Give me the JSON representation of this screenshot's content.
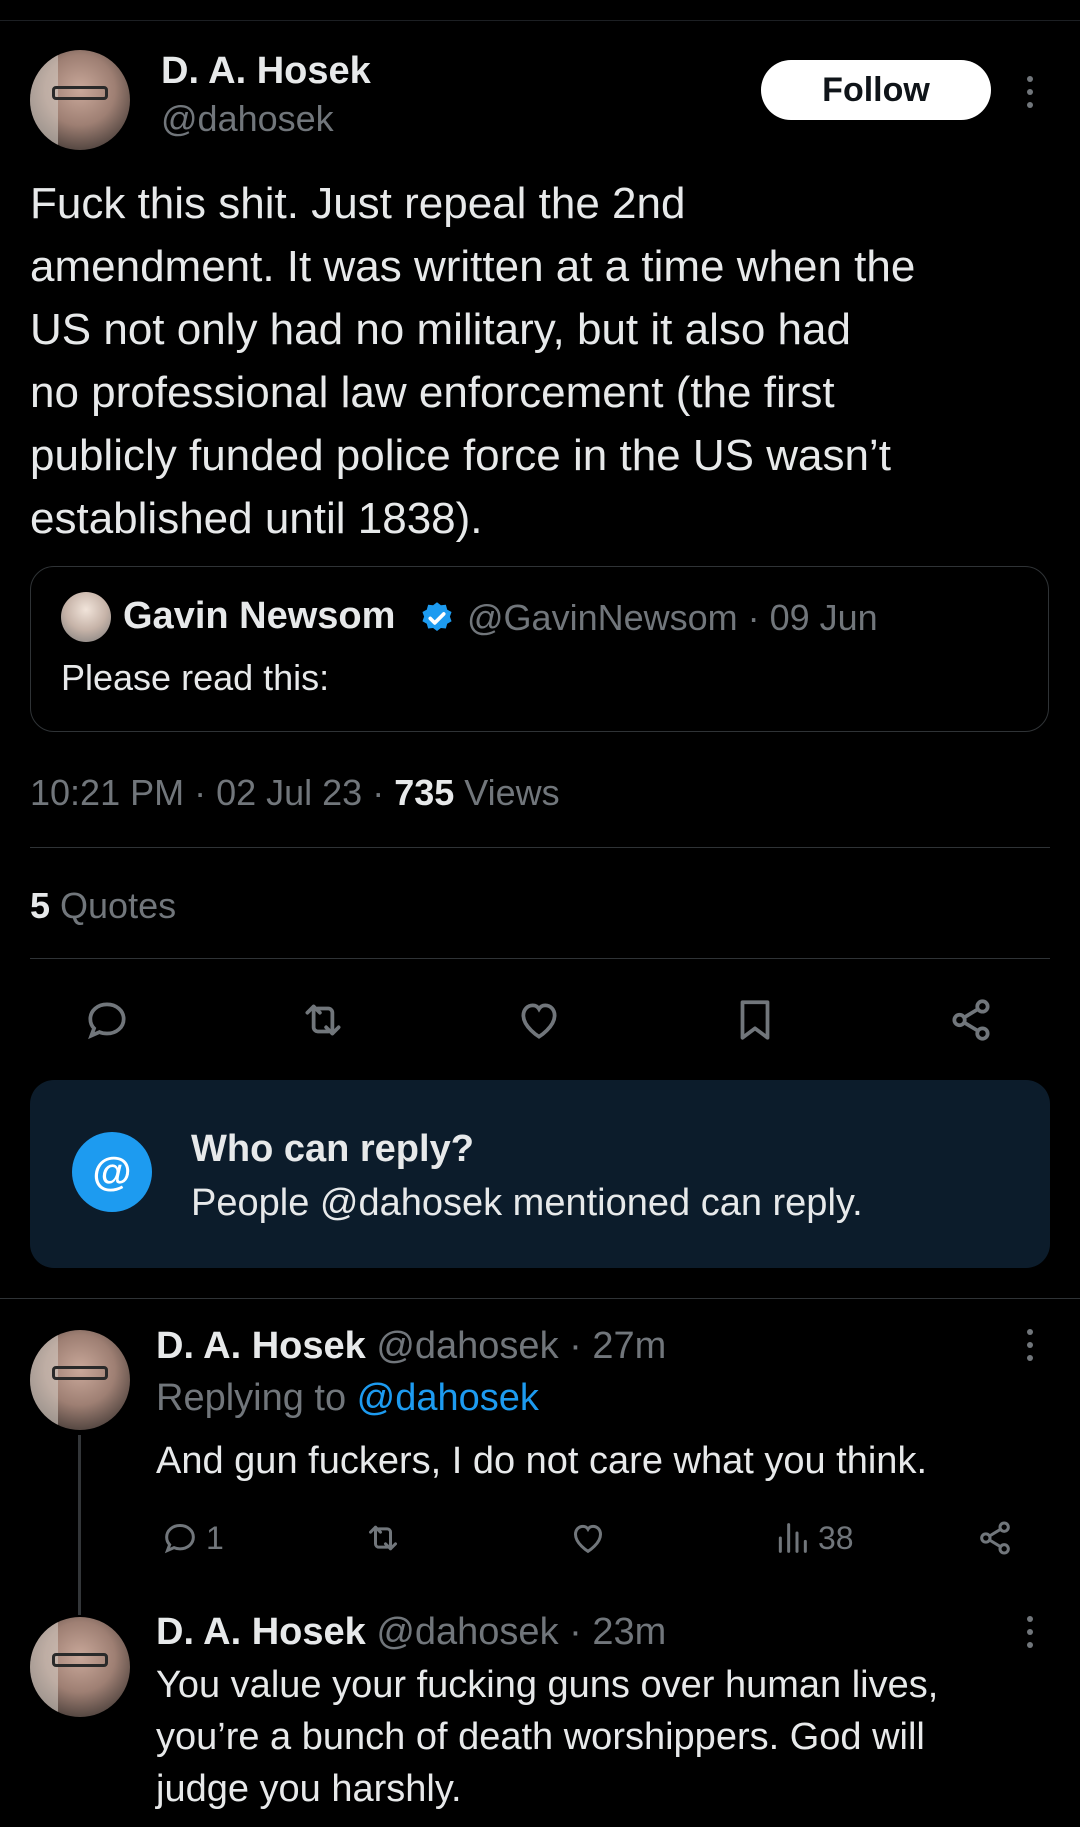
{
  "main_tweet": {
    "author_name": "D. A. Hosek",
    "author_handle": "@dahosek",
    "follow_label": "Follow",
    "text_lines": [
      "Fuck this shit. Just repeal the 2nd",
      "amendment. It was written at a time when the",
      "US not only had no military, but it also had",
      "no professional law enforcement (the first",
      "publicly funded police force in the US wasn’t",
      "established until 1838)."
    ],
    "quoted": {
      "author_name": "Gavin Newsom",
      "handle_and_date": "@GavinNewsom · 09 Jun",
      "text": "Please read this:"
    },
    "timestamp": "10:21 PM · 02 Jul 23 · ",
    "views_count": "735",
    "views_label": " Views",
    "quotes_count": "5",
    "quotes_label": " Quotes",
    "actions": [
      "reply-icon",
      "retweet-icon",
      "like-icon",
      "bookmark-icon",
      "share-icon"
    ]
  },
  "who_can_reply": {
    "icon": "@",
    "title": "Who can reply?",
    "text": "People @dahosek mentioned can reply."
  },
  "replies": [
    {
      "author_name": "D. A. Hosek",
      "handle_time": " @dahosek · 27m",
      "replying_prefix": "Replying to ",
      "replying_to": "@dahosek",
      "text_lines": [
        "And gun fuckers, I do not care what you think."
      ],
      "reply_count": "1",
      "views_count": "38"
    },
    {
      "author_name": "D. A. Hosek",
      "handle_time": " @dahosek · 23m",
      "text_lines": [
        "You value your fucking guns over human lives,",
        "you’re a bunch of death worshippers. God will",
        "judge you harshly."
      ]
    }
  ],
  "colors": {
    "background": "#000000",
    "text": "#e7e9ea",
    "muted": "#71767b",
    "accent": "#1d9bf0",
    "info_box": "#0c1c2b"
  }
}
